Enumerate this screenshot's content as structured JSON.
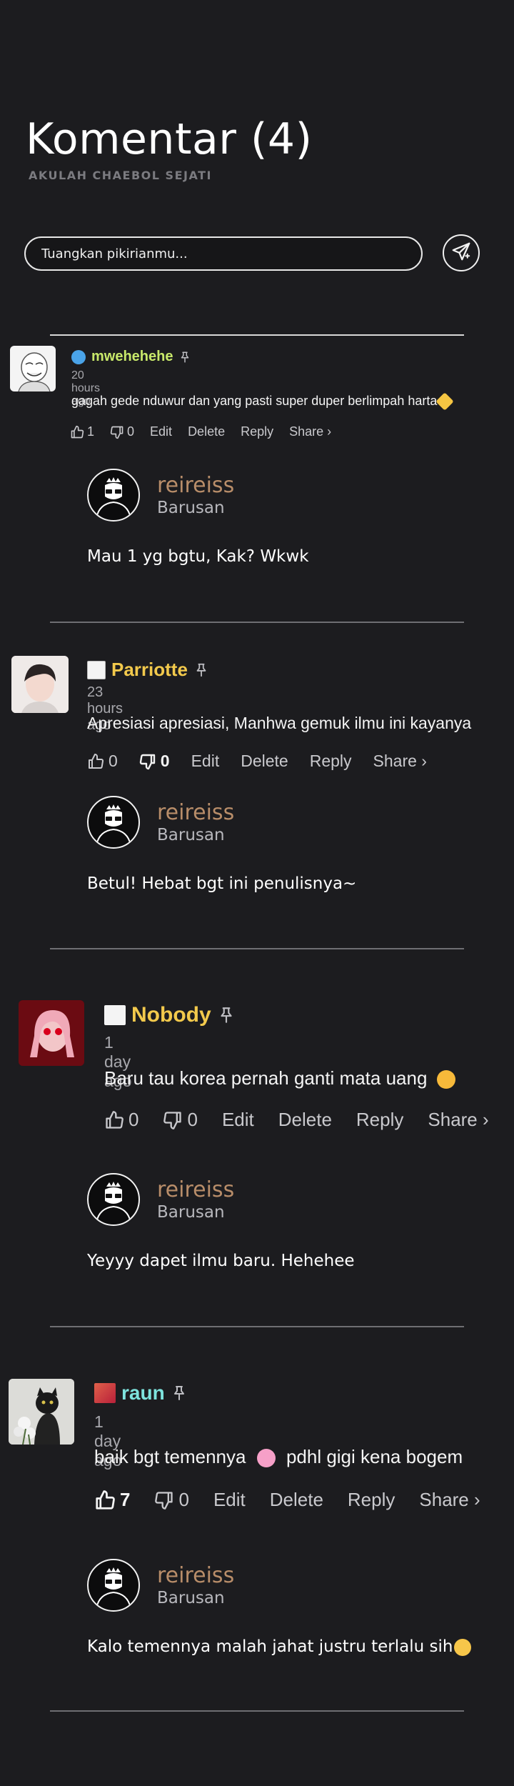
{
  "header": {
    "title": "Komentar (4)",
    "subtitle": "AKULAH CHAEBOL SEJATI"
  },
  "composer": {
    "placeholder": "Tuangkan pikirianmu...",
    "send_icon": "send-icon"
  },
  "comments": [
    {
      "username": "mwehehehe",
      "name_color": "#c8e86a",
      "flag_icon": "hands-emoji-icon",
      "time": "20 hours ago",
      "text": "gagah gede nduwur dan yang pasti super duper berlimpah harta",
      "text_emoji": "sparkles-emoji-icon",
      "likes": "1",
      "dislikes": "0",
      "edit_label": "Edit",
      "delete_label": "Delete",
      "reply_label": "Reply",
      "share_label": "Share ›",
      "reply": {
        "username": "reireiss",
        "time": "Barusan",
        "text": "Mau 1 yg bgtu, Kak? Wkwk"
      }
    },
    {
      "username": "Parriotte",
      "name_color": "#f2c94c",
      "flag_icon": "flag-icon",
      "time": "23 hours ago",
      "text": "Apresiasi apresiasi, Manhwa gemuk ilmu ini kayanya",
      "text_emoji": "",
      "likes": "0",
      "dislikes": "0",
      "edit_label": "Edit",
      "delete_label": "Delete",
      "reply_label": "Reply",
      "share_label": "Share ›",
      "reply": {
        "username": "reireiss",
        "time": "Barusan",
        "text": "Betul! Hebat bgt ini penulisnya~"
      }
    },
    {
      "username": "Nobody",
      "name_color": "#f2c94c",
      "flag_icon": "flag-icon",
      "time": "1 day ago",
      "text": "Baru tau korea pernah ganti mata uang",
      "text_emoji": "flushed-emoji-icon",
      "likes": "0",
      "dislikes": "0",
      "edit_label": "Edit",
      "delete_label": "Delete",
      "reply_label": "Reply",
      "share_label": "Share ›",
      "reply": {
        "username": "reireiss",
        "time": "Barusan",
        "text": "Yeyyy dapet ilmu baru. Hehehee"
      }
    },
    {
      "username": "raun",
      "name_color": "#7ee3dd",
      "flag_icon": "flag-icon",
      "time": "1 day ago",
      "text": "baik bgt temennya",
      "text_emoji": "scream-emoji-icon",
      "text_after": "pdhl gigi kena bogem",
      "likes": "7",
      "dislikes": "0",
      "edit_label": "Edit",
      "delete_label": "Delete",
      "reply_label": "Reply",
      "share_label": "Share ›",
      "reply": {
        "username": "reireiss",
        "time": "Barusan",
        "text": "Kalo temennya malah jahat justru terlalu sih",
        "text_emoji": "crying-emoji-icon"
      }
    }
  ]
}
